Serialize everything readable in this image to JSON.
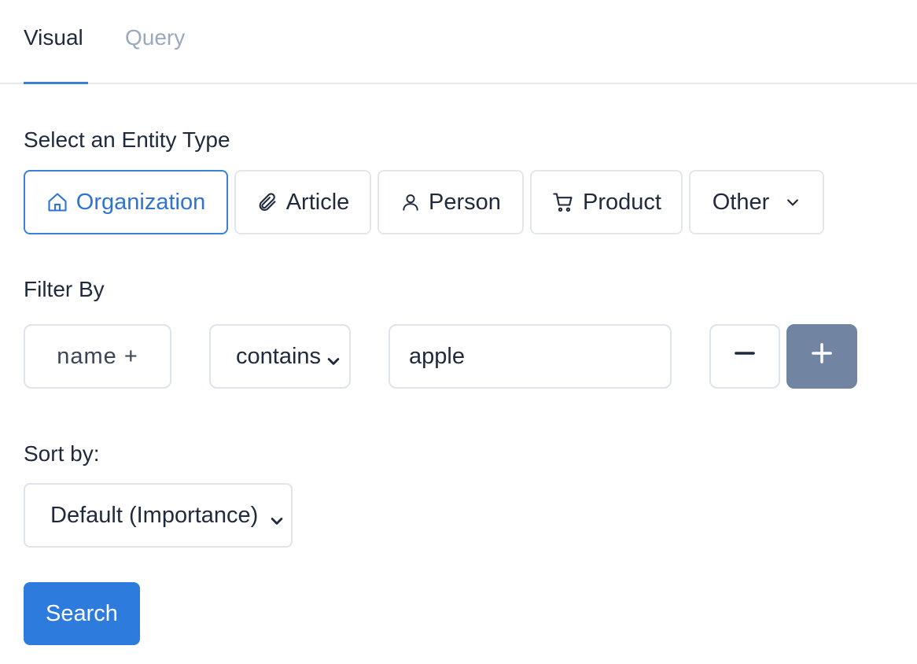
{
  "tabs": [
    {
      "label": "Visual",
      "active": true
    },
    {
      "label": "Query",
      "active": false
    }
  ],
  "entity_section": {
    "label": "Select an Entity Type",
    "options": [
      {
        "label": "Organization",
        "icon": "home-icon",
        "selected": true
      },
      {
        "label": "Article",
        "icon": "paperclip-icon",
        "selected": false
      },
      {
        "label": "Person",
        "icon": "person-icon",
        "selected": false
      },
      {
        "label": "Product",
        "icon": "cart-icon",
        "selected": false
      },
      {
        "label": "Other",
        "icon": "chevron-down-icon",
        "selected": false
      }
    ]
  },
  "filter": {
    "label": "Filter By",
    "field": "name +",
    "operator": "contains",
    "value": "apple",
    "remove_label": "−",
    "add_label": "+"
  },
  "sort": {
    "label": "Sort by:",
    "selected": "Default (Importance)"
  },
  "search_button": "Search",
  "colors": {
    "accent": "#3b82d6",
    "primary_button": "#2e7bde",
    "add_button": "#7185a3",
    "inactive_tab": "#9aa9bc"
  }
}
